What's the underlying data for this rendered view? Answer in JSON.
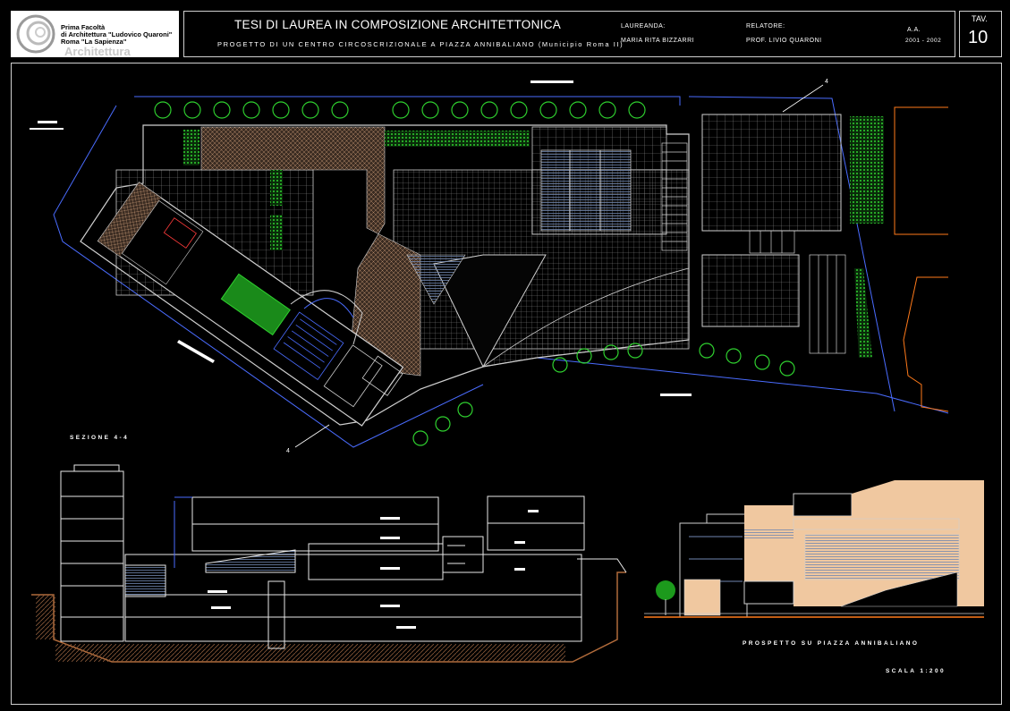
{
  "header": {
    "logo": {
      "line1": "Prima Facoltà",
      "line2": "di Architettura \"Ludovico Quaroni\"",
      "line3": "Roma \"La Sapienza\"",
      "watermark": "Architettura"
    },
    "title": "TESI DI LAUREA IN COMPOSIZIONE ARCHITETTONICA",
    "subtitle": "PROGETTO DI UN CENTRO CIRCOSCRIZIONALE A PIAZZA ANNIBALIANO (Municipio Roma II)",
    "laureanda_label": "LAUREANDA:",
    "laureanda_name": "MARIA RITA BIZZARRI",
    "relatore_label": "RELATORE:",
    "relatore_name": "PROF. LIVIO QUARONI",
    "aa_label": "A.A.",
    "aa_value": "2001 - 2002",
    "tav_label": "TAV.",
    "tav_number": "10"
  },
  "drawing": {
    "section_marker": "4",
    "section_title": "SEZIONE 4-4",
    "elevation_title": "PROSPETTO SU PIAZZA ANNIBALIANO",
    "scale": "SCALA 1:200"
  },
  "colors": {
    "background": "#000000",
    "linework": "#ffffff",
    "grid": "#9a9a9a",
    "trees": "#2fd12f",
    "blue_lines": "#4a6cff",
    "red_lines": "#ff3b3b",
    "paving": "#b48a6a",
    "facade": "#f0c8a0",
    "orange_outline": "#ff7a1a"
  }
}
